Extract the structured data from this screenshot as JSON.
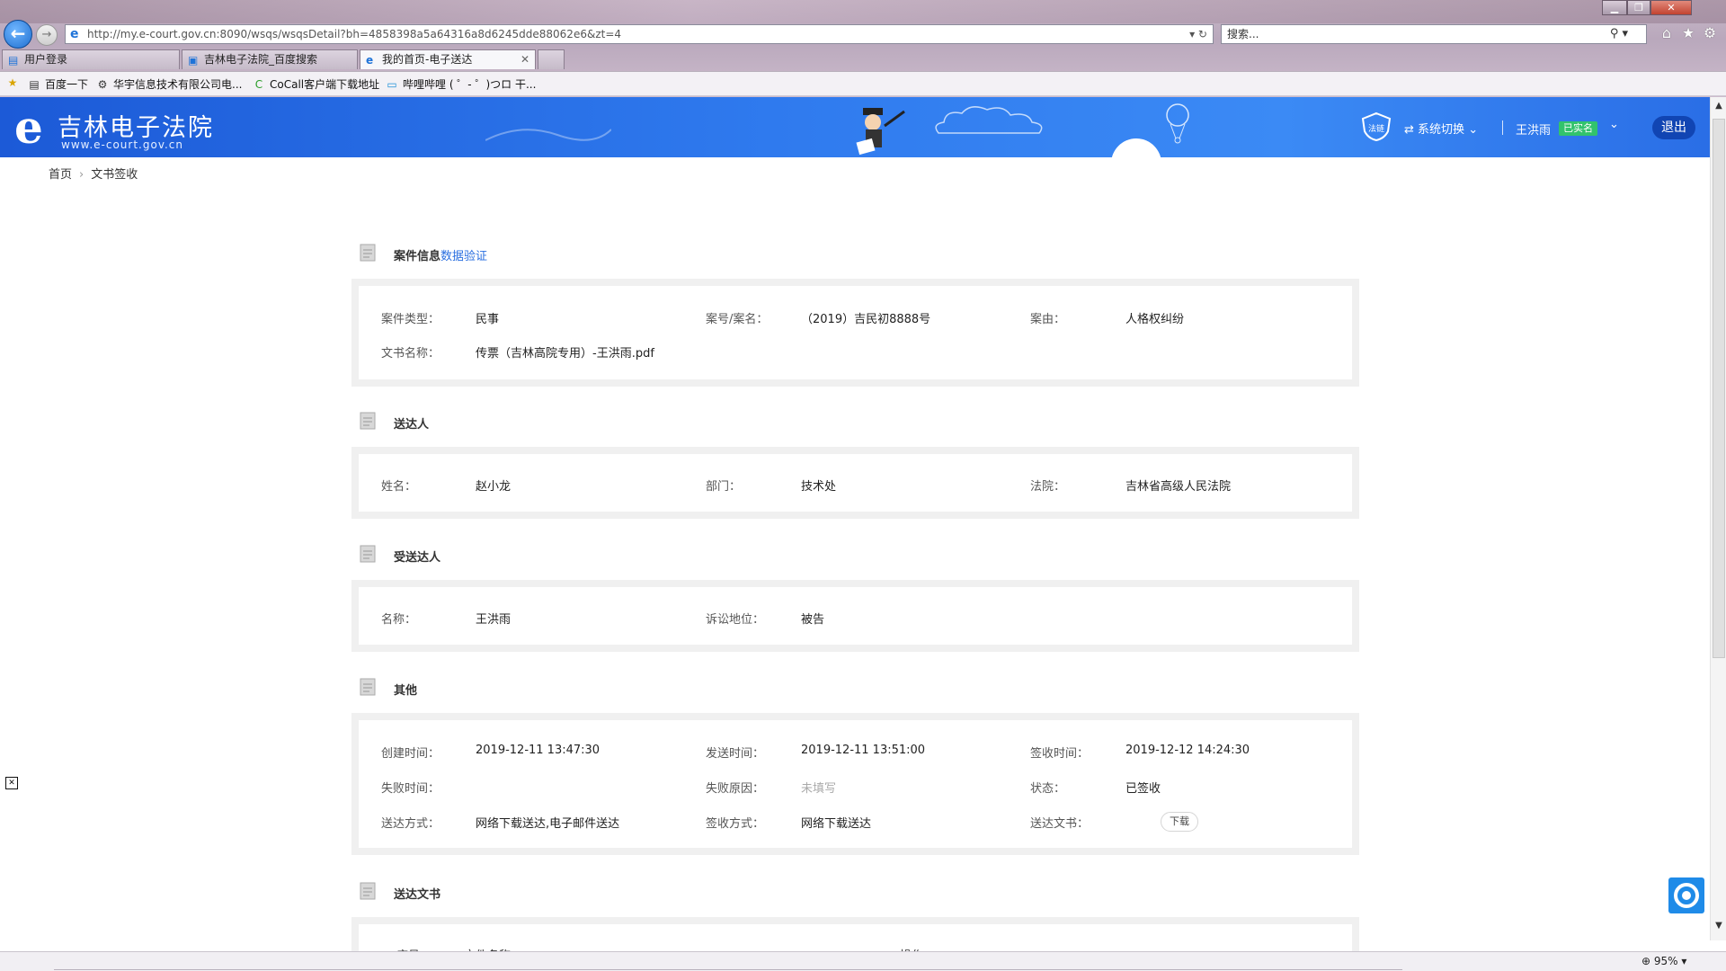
{
  "browser": {
    "address": "http://my.e-court.gov.cn:8090/wsqs/wsqsDetail?bh=4858398a5a64316a8d6245dde88062e6&zt=4",
    "search_placeholder": "搜索...",
    "tabs": [
      {
        "label": "用户登录",
        "active": false
      },
      {
        "label": "吉林电子法院_百度搜索",
        "active": false
      },
      {
        "label": "我的首页-电子送达",
        "active": true
      }
    ],
    "favorites": [
      {
        "label": "百度一下"
      },
      {
        "label": "华宇信息技术有限公司电..."
      },
      {
        "label": "CoCall客户端下载地址"
      },
      {
        "label": "哔哩哔哩 ( ゜- ゜)つロ 干..."
      }
    ],
    "zoom": "95%"
  },
  "header": {
    "site_name": "吉林电子法院",
    "site_url": "www.e-court.gov.cn",
    "brand_small": "法链",
    "system_switch": "系统切换",
    "user_name": "王洪雨",
    "user_badge": "已实名",
    "logout": "退出"
  },
  "breadcrumb": {
    "home": "首页",
    "current": "文书签收"
  },
  "sections": {
    "case": {
      "title": "案件信息",
      "link": "数据验证",
      "fields": {
        "case_type_label": "案件类型：",
        "case_type": "民事",
        "case_no_label": "案号/案名：",
        "case_no": "（2019）吉民初8888号",
        "cause_label": "案由：",
        "cause": "人格权纠纷",
        "doc_name_label": "文书名称：",
        "doc_name": "传票（吉林高院专用）-王洪雨.pdf"
      }
    },
    "sender": {
      "title": "送达人",
      "fields": {
        "name_label": "姓名：",
        "name": "赵小龙",
        "dept_label": "部门：",
        "dept": "技术处",
        "court_label": "法院：",
        "court": "吉林省高级人民法院"
      }
    },
    "recipient": {
      "title": "受送达人",
      "fields": {
        "name_label": "名称：",
        "name": "王洪雨",
        "role_label": "诉讼地位：",
        "role": "被告"
      }
    },
    "other": {
      "title": "其他",
      "fields": {
        "created_label": "创建时间：",
        "created": "2019-12-11 13:47:30",
        "sent_label": "发送时间：",
        "sent": "2019-12-11 13:51:00",
        "signed_label": "签收时间：",
        "signed": "2019-12-12 14:24:30",
        "fail_time_label": "失败时间：",
        "fail_time": "",
        "fail_reason_label": "失败原因：",
        "fail_reason": "未填写",
        "status_label": "状态：",
        "status": "已签收",
        "delivery_label": "送达方式：",
        "delivery": "网络下载送达,电子邮件送达",
        "sign_method_label": "签收方式：",
        "sign_method": "网络下载送达",
        "doc_label": "送达文书：",
        "download": "下载"
      }
    },
    "docs": {
      "title": "送达文书",
      "columns": [
        "序号",
        "文件名称",
        "操作"
      ]
    }
  },
  "colors": {
    "header_blue": "#2f7aee",
    "link_blue": "#2a6fe0",
    "badge_green": "#32c36c",
    "panel_gray": "#f0f0f0"
  }
}
